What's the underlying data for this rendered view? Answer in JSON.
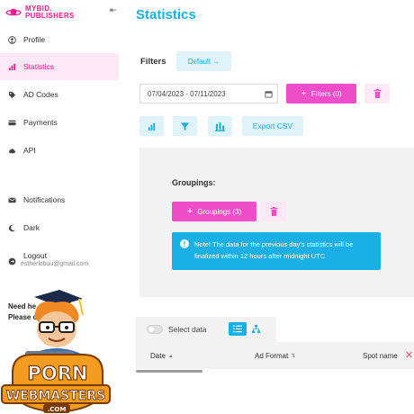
{
  "brand": {
    "line1": "MYBID.",
    "line2": "PUBLISHERS",
    "collapse_icon": "collapse-arrow-icon"
  },
  "sidebar": {
    "items": [
      {
        "label": "Profile",
        "icon": "user-circle-icon",
        "active": false
      },
      {
        "label": "Statistics",
        "icon": "bar-chart-icon",
        "active": true
      },
      {
        "label": "AD Codes",
        "icon": "tag-icon",
        "active": false
      },
      {
        "label": "Payments",
        "icon": "card-icon",
        "active": false
      },
      {
        "label": "API",
        "icon": "cloud-icon",
        "active": false
      },
      {
        "label": "Notifications",
        "icon": "mail-icon",
        "active": false
      },
      {
        "label": "Dark",
        "icon": "moon-icon",
        "active": false
      },
      {
        "label": "Logout",
        "icon": "logout-icon",
        "active": false
      }
    ],
    "email": "estherkibuu@gmail.com",
    "need_help_line1": "Need he",
    "need_help_line2": "Please c"
  },
  "badge": {
    "top": "PORN",
    "bottom": "WEBMASTERS",
    "sub": ".COM"
  },
  "page": {
    "title": "Statistics"
  },
  "filters": {
    "label": "Filters",
    "default_label": "Default →",
    "date_range": "07/04/2023 - 07/11/2023",
    "filters_button": "Filters (0)"
  },
  "toolbar": {
    "export_label": "Export CSV"
  },
  "groupings": {
    "label": "Groupings:",
    "button": "Groupings (3)",
    "note": "Note! The data for the previous day's statistics will be finalized within 12 hours after midnight UTC"
  },
  "table": {
    "select_label": "Select data",
    "columns": [
      {
        "label": "Date",
        "sort": "▲"
      },
      {
        "label": "Ad Format",
        "sort": "⇅"
      },
      {
        "label": "Spot name",
        "sort": ""
      }
    ]
  },
  "colors": {
    "accent": "#1ab0d9",
    "pink": "#ee4fc8",
    "active_bg": "#fde8f6"
  }
}
